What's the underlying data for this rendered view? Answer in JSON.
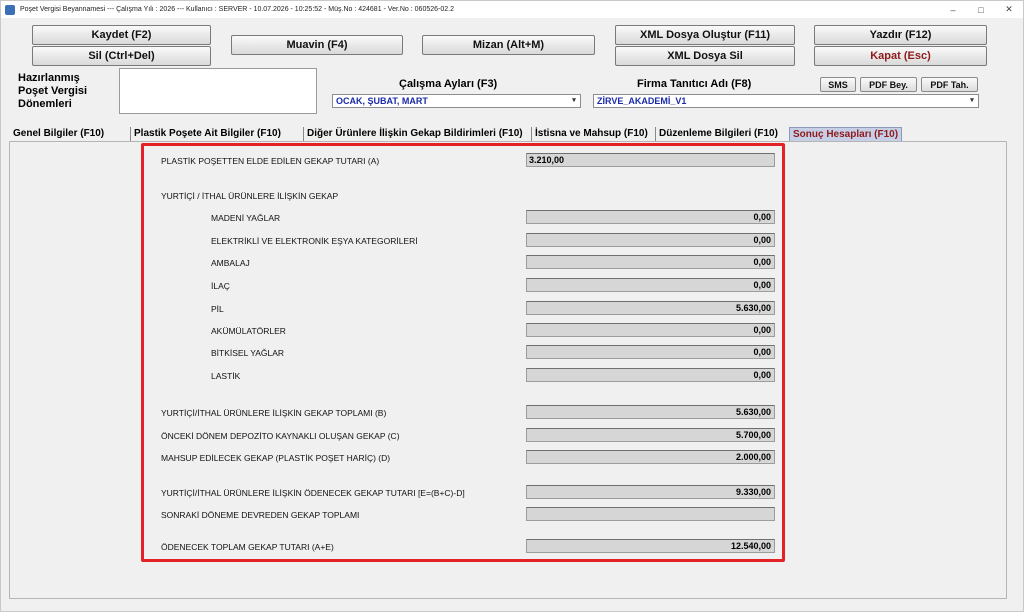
{
  "titlebar": {
    "text": "Poşet Vergisi Beyannamesi  ---  Çalışma Yılı : 2026  ---  Kullanıcı : SERVER - 10.07.2026 - 10:25:52 - Müş.No : 424681 - Ver.No : 060526-02.2",
    "minimize": "–",
    "maximize": "□",
    "close": "✕"
  },
  "toolbar": {
    "save": "Kaydet (F2)",
    "delete": "Sil (Ctrl+Del)",
    "muavin": "Muavin (F4)",
    "mizan": "Mizan (Alt+M)",
    "xml_create": "XML Dosya Oluştur (F11)",
    "xml_delete": "XML Dosya Sil",
    "print": "Yazdır (F12)",
    "close": "Kapat (Esc)"
  },
  "header": {
    "prepared_label_1": "Hazırlanmış",
    "prepared_label_2": "Poşet Vergisi",
    "prepared_label_3": "Dönemleri",
    "working_months_label": "Çalışma Ayları (F3)",
    "working_months_value": "OCAK, ŞUBAT, MART",
    "company_label": "Firma Tanıtıcı Adı (F8)",
    "company_value": "ZİRVE_AKADEMİ_V1",
    "sms": "SMS",
    "pdf_bey": "PDF Bey.",
    "pdf_tah": "PDF Tah."
  },
  "tabs": [
    {
      "label": "Genel Bilgiler (F10)"
    },
    {
      "label": "Plastik Poşete Ait Bilgiler (F10)"
    },
    {
      "label": "Diğer Ürünlere İlişkin Gekap Bildirimleri (F10)"
    },
    {
      "label": "İstisna ve Mahsup (F10)"
    },
    {
      "label": "Düzenleme Bilgileri (F10)"
    },
    {
      "label": "Sonuç Hesapları (F10)"
    }
  ],
  "results": {
    "plastic_bag_label": "PLASTİK POŞETTEN ELDE EDİLEN GEKAP TUTARI (A)",
    "plastic_bag_value": "3.210,00",
    "domestic_section": "YURTİÇİ / İTHAL ÜRÜNLERE İLİŞKİN GEKAP",
    "items": [
      {
        "label": "MADENİ YAĞLAR",
        "value": "0,00"
      },
      {
        "label": "ELEKTRİKLİ VE ELEKTRONİK EŞYA KATEGORİLERİ",
        "value": "0,00"
      },
      {
        "label": "AMBALAJ",
        "value": "0,00"
      },
      {
        "label": "İLAÇ",
        "value": "0,00"
      },
      {
        "label": "PİL",
        "value": "5.630,00"
      },
      {
        "label": "AKÜMÜLATÖRLER",
        "value": "0,00"
      },
      {
        "label": "BİTKİSEL YAĞLAR",
        "value": "0,00"
      },
      {
        "label": "LASTİK",
        "value": "0,00"
      }
    ],
    "totals": [
      {
        "label": "YURTİÇİ/İTHAL ÜRÜNLERE İLİŞKİN GEKAP TOPLAMI (B)",
        "value": "5.630,00"
      },
      {
        "label": "ÖNCEKİ DÖNEM DEPOZİTO KAYNAKLI OLUŞAN GEKAP (C)",
        "value": "5.700,00"
      },
      {
        "label": "MAHSUP EDİLECEK GEKAP (PLASTİK POŞET HARİÇ) (D)",
        "value": "2.000,00"
      }
    ],
    "payable_label": "YURTİÇİ/İTHAL ÜRÜNLERE İLİŞKİN ÖDENECEK GEKAP TUTARI [E=(B+C)-D]",
    "payable_value": "9.330,00",
    "carry_label": "SONRAKİ DÖNEME DEVREDEN GEKAP TOPLAMI",
    "carry_value": "",
    "grand_label": "ÖDENECEK TOPLAM GEKAP TUTARI (A+E)",
    "grand_value": "12.540,00"
  },
  "colors": {
    "highlight": "#e22226",
    "active_tab_text": "#8e1a1a",
    "combo_text": "#1a2aa8"
  }
}
